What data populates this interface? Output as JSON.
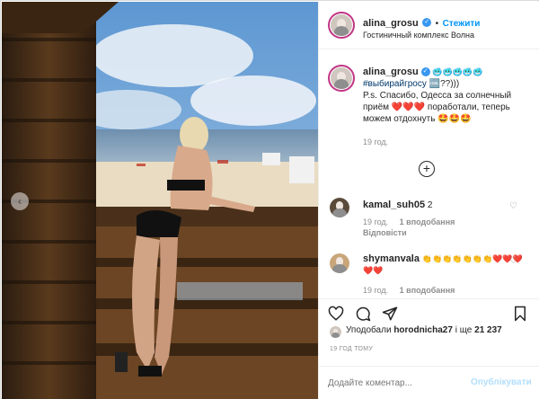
{
  "post": {
    "username": "alina_grosu",
    "follow_label": "Стежити",
    "location": "Гостиничный комплекс Волна",
    "caption_username": "alina_grosu",
    "caption_emoji_line": "🥶🥶🥶🥶🥶",
    "caption_hashtag": "#выбирайгросу",
    "caption_hashtag_suffix": "🆒??)))",
    "caption_text": "P.s. Спасибо, Одесса за солнечный приём ❤️❤️❤️ поработали, теперь можем отдохнуть 🤩🤩🤩",
    "caption_time": "19 год."
  },
  "comments": [
    {
      "username": "kamal_suh05",
      "text": "2",
      "time": "19 год.",
      "likes": "1 вподобання",
      "reply": "Відповісти"
    },
    {
      "username": "shymanvala",
      "text": "👏👏👏👏👏👏👏❤️❤️❤️❤️❤️",
      "time": "19 год.",
      "likes": "1 вподобання"
    }
  ],
  "likes_line": {
    "prefix": "Уподобали",
    "user": "horodnicha27",
    "suffix": "і ще",
    "count": "21 237"
  },
  "time_ago": "19 ГОД ТОМУ",
  "comment_box": {
    "placeholder": "Додайте коментар...",
    "publish_label": "Опублікувати"
  },
  "colors": {
    "accent": "#0095f6",
    "text": "#262626",
    "muted": "#8e8e8e"
  }
}
